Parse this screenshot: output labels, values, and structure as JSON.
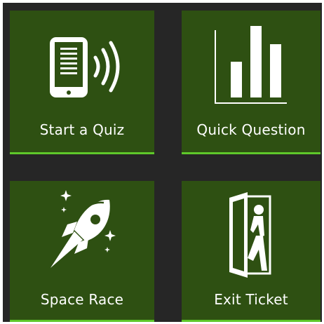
{
  "tiles": [
    {
      "label": "Start a Quiz",
      "icon": "tablet-broadcast-icon"
    },
    {
      "label": "Quick Question",
      "icon": "bar-chart-icon"
    },
    {
      "label": "Space Race",
      "icon": "rocket-icon"
    },
    {
      "label": "Exit Ticket",
      "icon": "exit-door-icon"
    }
  ],
  "colors": {
    "background": "#262626",
    "tile": "#2e5012",
    "tile_accent": "#5ec82a",
    "text": "#ffffff"
  }
}
